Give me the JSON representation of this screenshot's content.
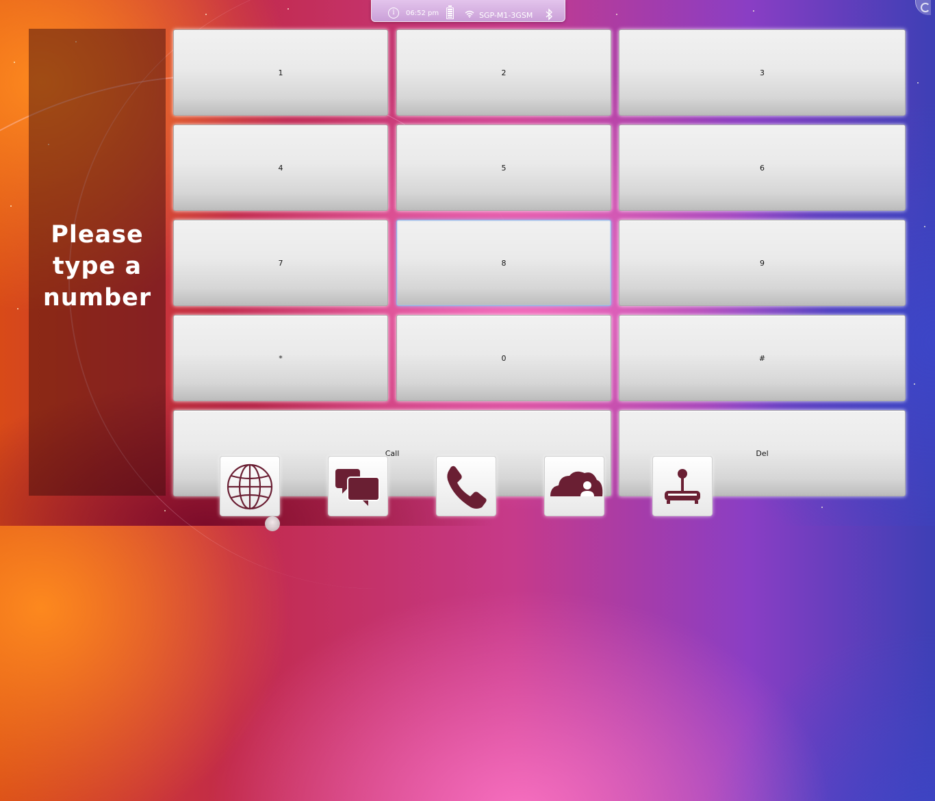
{
  "status_bar": {
    "time": "06:52 pm",
    "network": "SGP-M1-3GSM",
    "icons": [
      "info-icon",
      "battery-icon",
      "wifi-icon",
      "bluetooth-icon"
    ]
  },
  "prompt": {
    "text": "Please type a number"
  },
  "keypad": {
    "keys": [
      "1",
      "2",
      "3",
      "4",
      "5",
      "6",
      "7",
      "8",
      "9",
      "*",
      "0",
      "#"
    ],
    "call_label": "Call",
    "del_label": "Del",
    "focused_key": "8"
  },
  "dock": {
    "items": [
      "globe-icon",
      "chat-icon",
      "phone-icon",
      "cloud-contact-icon",
      "joystick-icon"
    ]
  },
  "colors": {
    "key_focus_border": "#8fb3e8",
    "icon_color": "#6a1f33"
  }
}
